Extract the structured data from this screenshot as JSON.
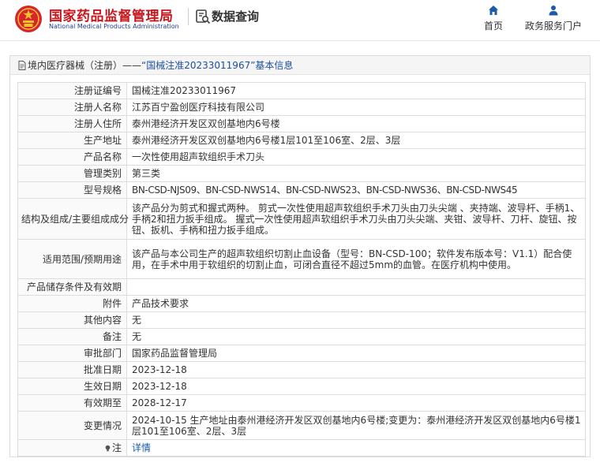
{
  "header": {
    "logo_cn": "国家药品监督管理局",
    "logo_en": "National Medical Products Administration",
    "section": "数据查询",
    "nav": [
      {
        "label": "首页",
        "icon": "home-icon"
      },
      {
        "label": "政务服务门户",
        "icon": "user-icon"
      }
    ]
  },
  "breadcrumb": {
    "part1": "境内医疗器械（注册）——",
    "part2": "“国械注准20233011967”基本信息"
  },
  "table": {
    "rows": [
      {
        "label": "注册证编号",
        "value": "国械注准20233011967"
      },
      {
        "label": "注册人名称",
        "value": "江苏百宁盈创医疗科技有限公司"
      },
      {
        "label": "注册人住所",
        "value": "泰州港经济开发区双创基地内6号楼"
      },
      {
        "label": "生产地址",
        "value": "泰州港经济开发区双创基地内6号楼1层101至106室、2层、3层"
      },
      {
        "label": "产品名称",
        "value": "一次性使用超声软组织手术刀头"
      },
      {
        "label": "管理类别",
        "value": "第三类"
      },
      {
        "label": "型号规格",
        "value": "BN-CSD-NJS09、BN-CSD-NWS14、BN-CSD-NWS23、BN-CSD-NWS36、BN-CSD-NWS45"
      },
      {
        "label": "结构及组成/主要组成成分",
        "value": "该产品分为剪式和握式两种。 剪式一次性使用超声软组织手术刀头由刀头尖端 、夹持端、波导杆、手柄1、手柄2和扭力扳手组成。 握式一次性使用超声软组织手术刀头由刀头尖端、夹钳、波导杆、刀杆、旋钮、按钮、扳机、手柄和扭力扳手组成。"
      },
      {
        "label": "适用范围/预期用途",
        "value": "该产品与本公司生产的超声软组织切割止血设备（型号：BN-CSD-100；软件发布版本号：V1.1）配合使用，在手术中用于软组织的切割止血，可闭合直径不超过5mm的血管。在医疗机构中使用。"
      },
      {
        "label": "产品储存条件及有效期",
        "value": ""
      },
      {
        "label": "附件",
        "value": "产品技术要求"
      },
      {
        "label": "其他内容",
        "value": "无"
      },
      {
        "label": "备注",
        "value": "无"
      },
      {
        "label": "审批部门",
        "value": "国家药品监督管理局"
      },
      {
        "label": "批准日期",
        "value": "2023-12-18"
      },
      {
        "label": "生效日期",
        "value": "2023-12-18"
      },
      {
        "label": "有效期至",
        "value": "2028-12-17"
      },
      {
        "label": "变更情况",
        "value": "2024-10-15 生产地址由泰州港经济开发区双创基地内6号楼;变更为：泰州港经济开发区双创基地内6号楼1层101至106室、2层、3层"
      },
      {
        "label": "注",
        "value": "详情"
      }
    ]
  },
  "colors": {
    "logo_red": "#c8161d",
    "logo_blue": "#1d3f8c",
    "nav_blue": "#1d5ba8",
    "link_blue": "#1d5ba8"
  }
}
